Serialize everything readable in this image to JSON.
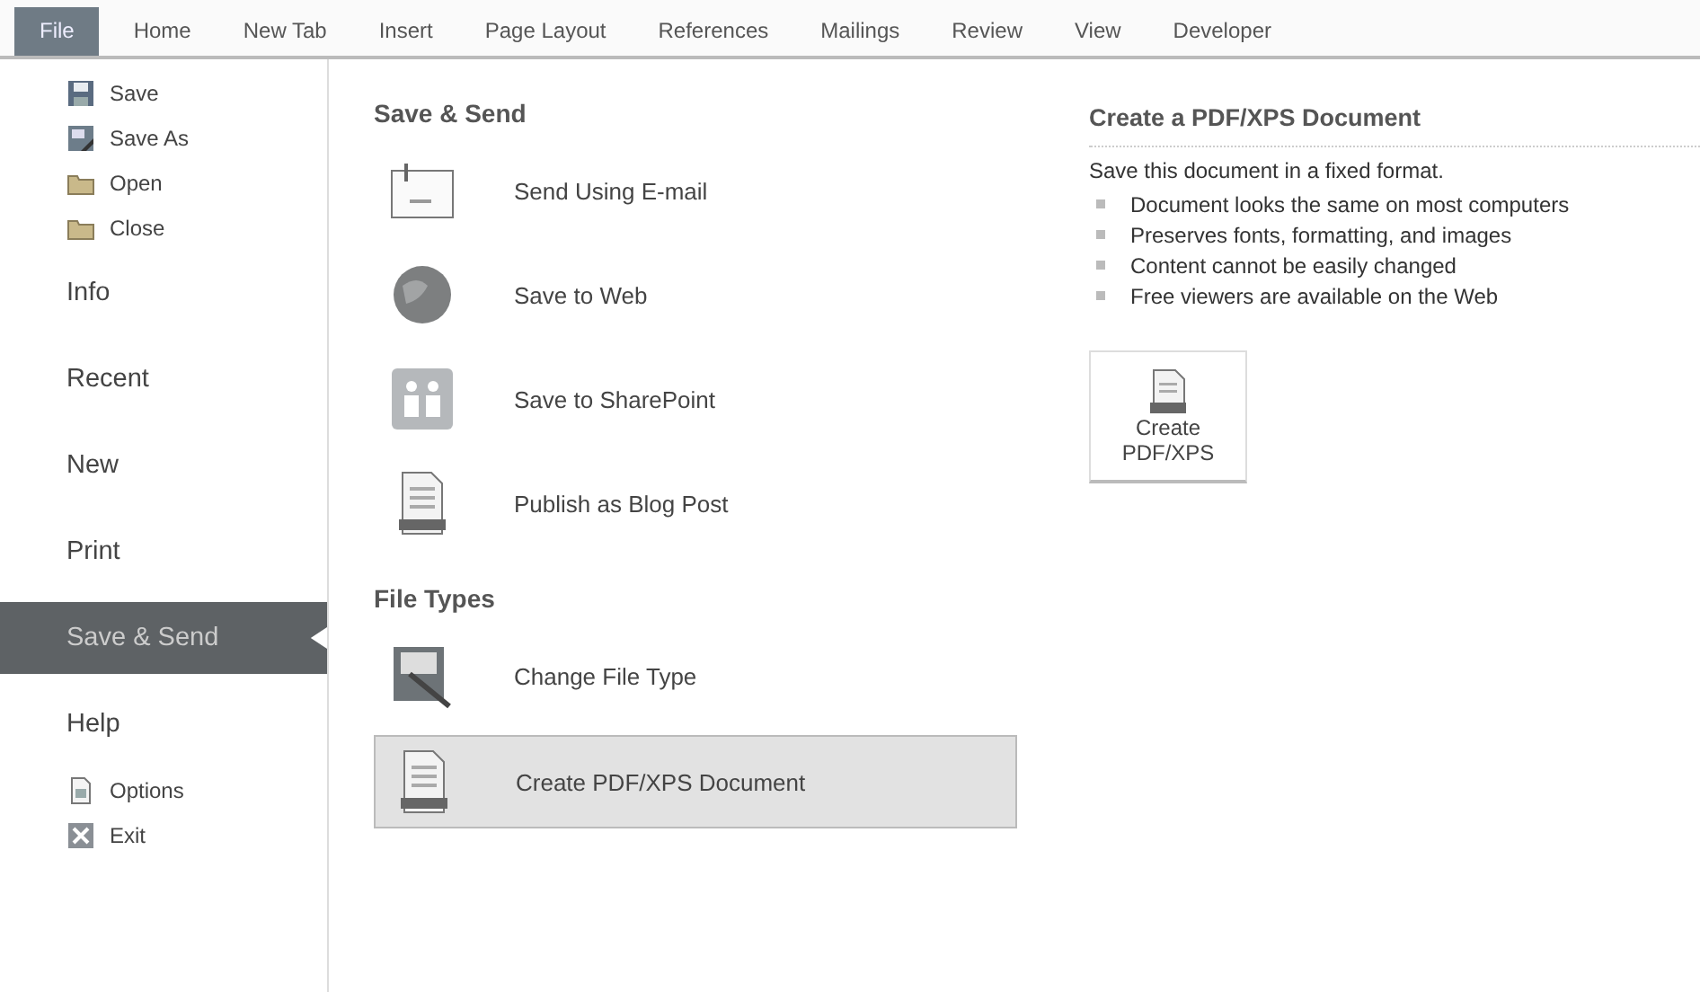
{
  "ribbon_tabs": [
    {
      "label": "File",
      "selected": true
    },
    {
      "label": "Home",
      "selected": false
    },
    {
      "label": "New Tab",
      "selected": false
    },
    {
      "label": "Insert",
      "selected": false
    },
    {
      "label": "Page Layout",
      "selected": false
    },
    {
      "label": "References",
      "selected": false
    },
    {
      "label": "Mailings",
      "selected": false
    },
    {
      "label": "Review",
      "selected": false
    },
    {
      "label": "View",
      "selected": false
    },
    {
      "label": "Developer",
      "selected": false
    }
  ],
  "sidebar": {
    "items": [
      {
        "kind": "command",
        "label": "Save"
      },
      {
        "kind": "command",
        "label": "Save As"
      },
      {
        "kind": "command",
        "label": "Open"
      },
      {
        "kind": "command",
        "label": "Close"
      },
      {
        "kind": "tab",
        "label": "Info",
        "selected": false
      },
      {
        "kind": "tab",
        "label": "Recent",
        "selected": false
      },
      {
        "kind": "tab",
        "label": "New",
        "selected": false
      },
      {
        "kind": "tab",
        "label": "Print",
        "selected": false
      },
      {
        "kind": "tab",
        "label": "Save & Send",
        "selected": true
      },
      {
        "kind": "tab",
        "label": "Help",
        "selected": false
      },
      {
        "kind": "command",
        "label": "Options"
      },
      {
        "kind": "command",
        "label": "Exit"
      }
    ]
  },
  "middle": {
    "sections": [
      {
        "title": "Save & Send",
        "items": [
          {
            "label": "Send Using E-mail",
            "selected": false
          },
          {
            "label": "Save to Web",
            "selected": false
          },
          {
            "label": "Save to SharePoint",
            "selected": false
          },
          {
            "label": "Publish as Blog Post",
            "selected": false
          }
        ]
      },
      {
        "title": "File Types",
        "items": [
          {
            "label": "Change File Type",
            "selected": false
          },
          {
            "label": "Create PDF/XPS Document",
            "selected": true
          }
        ]
      }
    ]
  },
  "detail": {
    "title": "Create a PDF/XPS Document",
    "intro": "Save this document in a fixed format.",
    "bullets": [
      "Document looks the same on most computers",
      "Preserves fonts, formatting, and images",
      "Content cannot be easily changed",
      "Free viewers are available on the Web"
    ],
    "button": {
      "label_lines": [
        "Create",
        "PDF/XPS"
      ]
    }
  }
}
